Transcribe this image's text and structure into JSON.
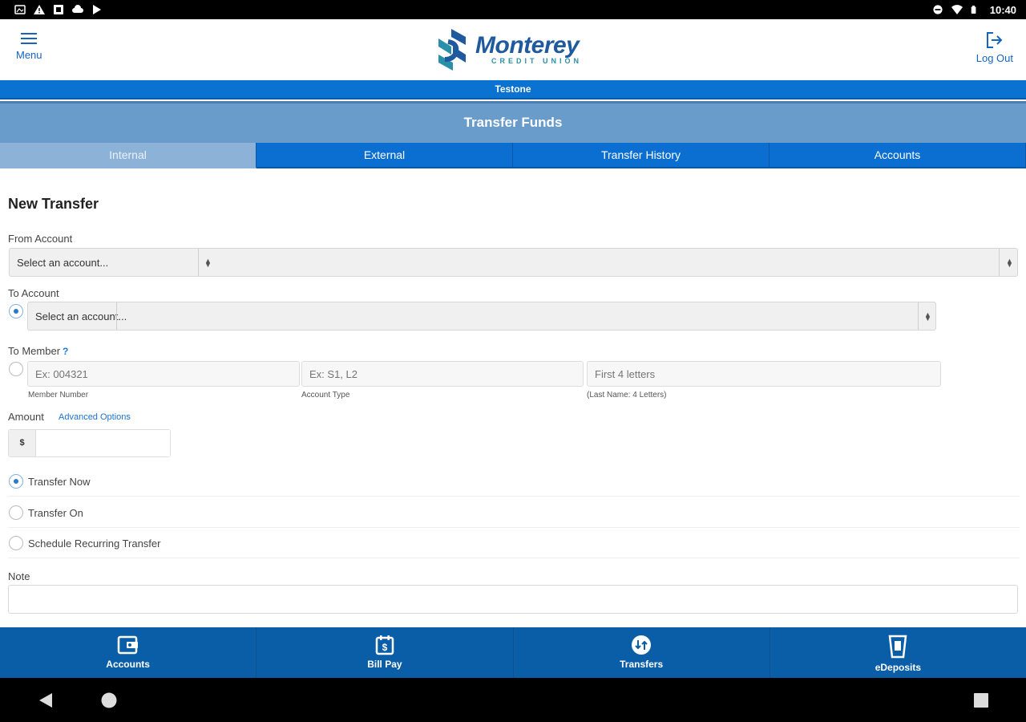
{
  "statusbar": {
    "time": "10:40"
  },
  "header": {
    "menu_label": "Menu",
    "logout_label": "Log Out",
    "logo_word": "Monterey",
    "logo_sub": "CREDIT UNION"
  },
  "userbar": {
    "username": "Testone"
  },
  "page": {
    "title": "Transfer Funds"
  },
  "tabs": [
    {
      "label": "Internal"
    },
    {
      "label": "External"
    },
    {
      "label": "Transfer History"
    },
    {
      "label": "Accounts"
    }
  ],
  "form": {
    "heading": "New Transfer",
    "from_account": {
      "label": "From Account",
      "value": "Select an account..."
    },
    "to_account": {
      "label": "To Account",
      "value": "Select an account..."
    },
    "to_member": {
      "label": "To Member",
      "help": "?",
      "member_number": {
        "placeholder": "Ex: 004321",
        "label": "Member Number"
      },
      "account_type": {
        "placeholder": "Ex: S1, L2",
        "label": "Account Type"
      },
      "last_name": {
        "placeholder": "First 4 letters",
        "label": "(Last Name: 4 Letters)"
      }
    },
    "amount": {
      "label": "Amount",
      "advanced_link": "Advanced Options",
      "currency": "$"
    },
    "timing_options": [
      {
        "label": "Transfer Now",
        "selected": true
      },
      {
        "label": "Transfer On",
        "selected": false
      },
      {
        "label": "Schedule Recurring Transfer",
        "selected": false
      }
    ],
    "note": {
      "label": "Note"
    }
  },
  "bottom_nav": [
    {
      "label": "Accounts",
      "icon": "wallet-icon"
    },
    {
      "label": "Bill Pay",
      "icon": "bill-calendar-icon"
    },
    {
      "label": "Transfers",
      "icon": "transfer-icon"
    },
    {
      "label": "eDeposits",
      "icon": "deposit-cup-icon"
    }
  ],
  "colors": {
    "primary_blue": "#0a6fd0",
    "nav_blue": "#0a5ea8",
    "title_bar": "#6a9ccb",
    "active_tab": "#8db2d8",
    "logo_blue": "#1f5a9e",
    "logo_teal": "#2a8fa8"
  }
}
